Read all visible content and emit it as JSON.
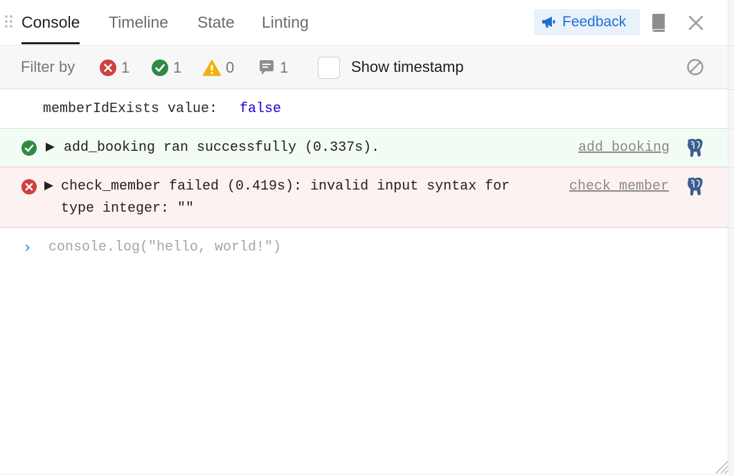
{
  "tabs": [
    {
      "label": "Console"
    },
    {
      "label": "Timeline"
    },
    {
      "label": "State"
    },
    {
      "label": "Linting"
    }
  ],
  "header": {
    "feedback_label": "Feedback"
  },
  "filter": {
    "label": "Filter by",
    "error_count": "1",
    "success_count": "1",
    "warning_count": "0",
    "info_count": "1",
    "show_timestamp_label": "Show timestamp"
  },
  "logs": {
    "plain": {
      "text": "memberIdExists value:",
      "value": "false"
    },
    "success": {
      "caret": "▶",
      "message": "add_booking ran successfully (0.337s).",
      "source": "add_booking"
    },
    "error": {
      "caret": "▶",
      "line1": "check_member failed (0.419s): invalid input syntax for",
      "line2": "type integer: \"\"",
      "source": "check_member"
    }
  },
  "console_input": {
    "prompt": "›",
    "placeholder": "console.log(\"hello, world!\")"
  },
  "colors": {
    "error": "#d0403f",
    "success": "#2f8a45",
    "warning": "#f2b10f",
    "accent": "#1f6fd1"
  },
  "icons": [
    "grip-icon",
    "megaphone-icon",
    "book-icon",
    "close-icon",
    "error-icon",
    "success-icon",
    "warning-icon",
    "comment-icon",
    "clear-icon",
    "postgres-icon",
    "resize-grip-icon"
  ]
}
